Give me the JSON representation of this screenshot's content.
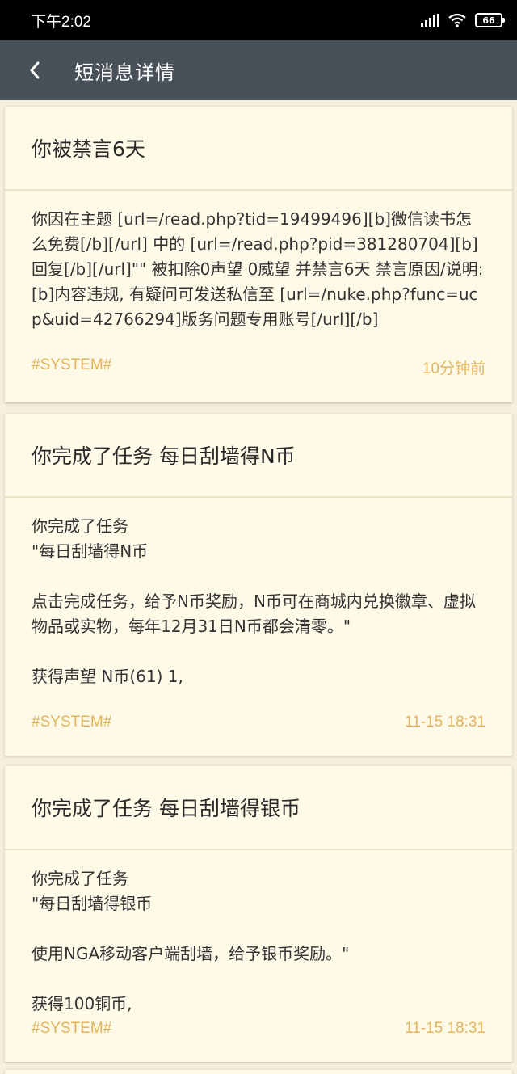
{
  "status_bar": {
    "time": "下午2:02",
    "battery": "66",
    "icons": [
      "signal-icon",
      "wifi-icon",
      "battery-icon"
    ]
  },
  "app_bar": {
    "title": "短消息详情",
    "back_icon": "back-arrow-icon"
  },
  "colors": {
    "status_bar_bg": "#000000",
    "app_bar_bg": "#48505a",
    "page_bg": "#f5efdc",
    "card_bg": "#fff9e8",
    "footer_text": "#e3b45c"
  },
  "messages": [
    {
      "title": "你被禁言6天",
      "body": "你因在主题 [url=/read.php?tid=19499496][b]微信读书怎么免费[/b][/url] 中的 [url=/read.php?pid=381280704][b]回复[/b][/url]\"\" 被扣除0声望 0威望 并禁言6天 禁言原因/说明:[b]内容违规, 有疑问可发送私信至 [url=/nuke.php?func=ucp&uid=42766294]版务问题专用账号[/url][/b]",
      "sender": "#SYSTEM#",
      "time": "10分钟前"
    },
    {
      "title": "你完成了任务 每日刮墙得N币",
      "body": "你完成了任务\n\"每日刮墙得N币\n\n点击完成任务，给予N币奖励，N币可在商城内兑换徽章、虚拟物品或实物，每年12月31日N币都会清零。\"\n\n获得声望 N币(61) 1,",
      "sender": "#SYSTEM#",
      "time": "11-15 18:31"
    },
    {
      "title": "你完成了任务 每日刮墙得银币",
      "body": "你完成了任务\n\"每日刮墙得银币\n\n使用NGA移动客户端刮墙，给予银币奖励。\"\n\n获得100铜币,",
      "sender": "#SYSTEM#",
      "time": "11-15 18:31"
    }
  ]
}
